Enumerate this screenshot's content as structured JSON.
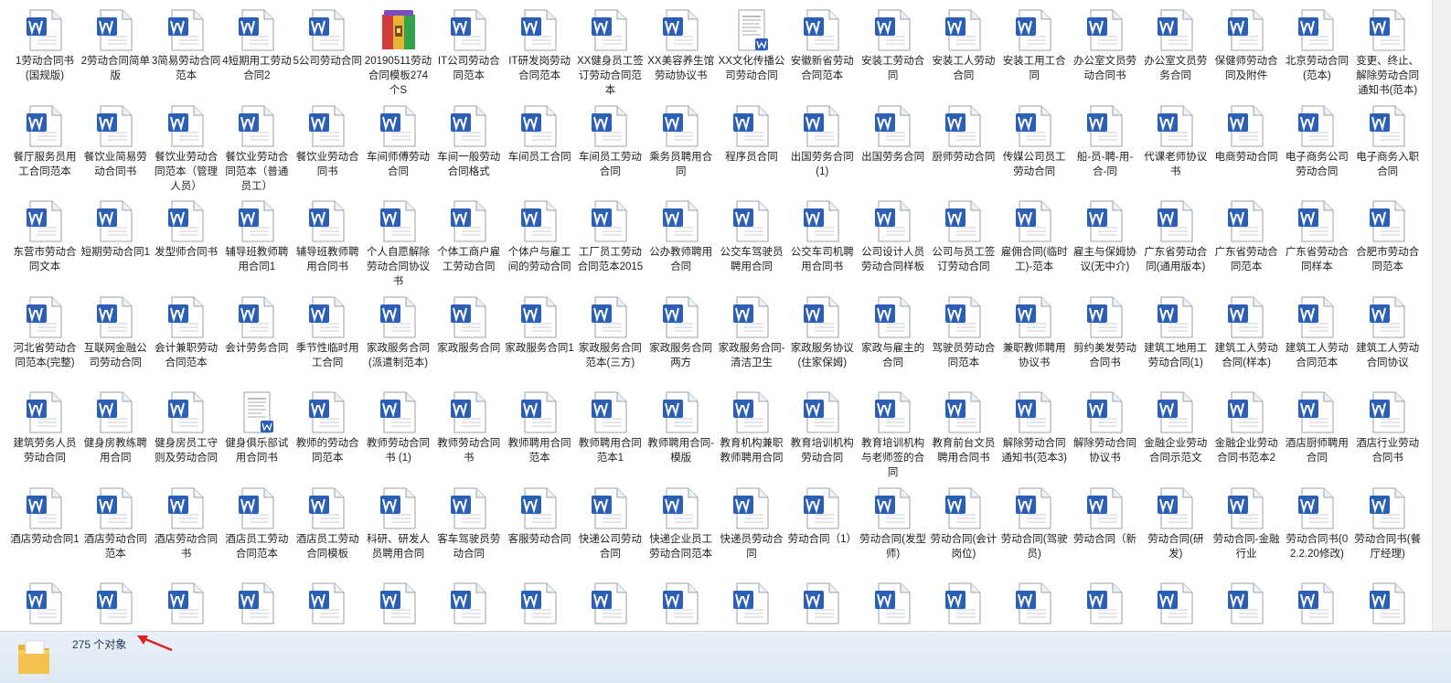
{
  "window": {
    "scrollbar": "vertical-scrollbar"
  },
  "files": [
    {
      "label": "1劳动合同书(国规版)",
      "icon": "word-doc-icon"
    },
    {
      "label": "2劳动合同简单版",
      "icon": "word-doc-icon"
    },
    {
      "label": "3简易劳动合同范本",
      "icon": "word-doc-icon"
    },
    {
      "label": "4短期用工劳动合同2",
      "icon": "word-doc-icon"
    },
    {
      "label": "5公司劳动合同",
      "icon": "word-doc-icon"
    },
    {
      "label": "20190511劳动合同模板274个S",
      "icon": "archive-icon"
    },
    {
      "label": "IT公司劳动合同范本",
      "icon": "word-doc-icon"
    },
    {
      "label": "IT研发岗劳动合同范本",
      "icon": "word-doc-icon"
    },
    {
      "label": "XX健身员工签订劳动合同范本",
      "icon": "word-doc-icon"
    },
    {
      "label": "XX美容养生馆劳动协议书",
      "icon": "word-doc-icon"
    },
    {
      "label": "XX文化传播公司劳动合同",
      "icon": "doc-thumbnail-icon"
    },
    {
      "label": "安徽新省劳动合同范本",
      "icon": "word-doc-icon"
    },
    {
      "label": "安装工劳动合同",
      "icon": "word-doc-icon"
    },
    {
      "label": "安装工人劳动合同",
      "icon": "word-doc-icon"
    },
    {
      "label": "安装工用工合同",
      "icon": "word-doc-icon"
    },
    {
      "label": "办公室文员劳动合同书",
      "icon": "word-doc-icon"
    },
    {
      "label": "办公室文员劳务合同",
      "icon": "word-doc-icon"
    },
    {
      "label": "保健师劳动合同及附件",
      "icon": "word-doc-icon"
    },
    {
      "label": "北京劳动合同(范本)",
      "icon": "word-doc-icon"
    },
    {
      "label": "变更、终止、解除劳动合同通知书(范本)",
      "icon": "word-doc-icon"
    },
    {
      "label": "餐厅服务员用工合同范本",
      "icon": "word-doc-icon"
    },
    {
      "label": "餐饮业简易劳动合同书",
      "icon": "word-doc-icon"
    },
    {
      "label": "餐饮业劳动合同范本（管理人员）",
      "icon": "word-doc-icon"
    },
    {
      "label": "餐饮业劳动合同范本（普通员工）",
      "icon": "word-doc-icon"
    },
    {
      "label": "餐饮业劳动合同书",
      "icon": "word-doc-icon"
    },
    {
      "label": "车间师傅劳动合同",
      "icon": "word-doc-icon"
    },
    {
      "label": "车间一般劳动合同格式",
      "icon": "word-doc-icon"
    },
    {
      "label": "车间员工合同",
      "icon": "word-doc-icon"
    },
    {
      "label": "车间员工劳动合同",
      "icon": "word-doc-icon"
    },
    {
      "label": "乘务员聘用合同",
      "icon": "word-doc-icon"
    },
    {
      "label": "程序员合同",
      "icon": "word-doc-icon"
    },
    {
      "label": "出国劳务合同 (1)",
      "icon": "word-doc-icon"
    },
    {
      "label": "出国劳务合同",
      "icon": "word-doc-icon"
    },
    {
      "label": "厨师劳动合同",
      "icon": "word-doc-icon"
    },
    {
      "label": "传媒公司员工劳动合同",
      "icon": "word-doc-icon"
    },
    {
      "label": "船-员-聘-用-合-同",
      "icon": "word-doc-icon"
    },
    {
      "label": "代课老师协议书",
      "icon": "word-doc-icon"
    },
    {
      "label": "电商劳动合同",
      "icon": "word-doc-icon"
    },
    {
      "label": "电子商务公司劳动合同",
      "icon": "word-doc-icon"
    },
    {
      "label": "电子商务入职合同",
      "icon": "word-doc-icon"
    },
    {
      "label": "东营市劳动合同文本",
      "icon": "word-doc-icon"
    },
    {
      "label": "短期劳动合同1",
      "icon": "word-doc-icon"
    },
    {
      "label": "发型师合同书",
      "icon": "word-doc-icon"
    },
    {
      "label": "辅导班教师聘用合同1",
      "icon": "word-doc-icon"
    },
    {
      "label": "辅导班教师聘用合同书",
      "icon": "word-doc-icon"
    },
    {
      "label": "个人自愿解除劳动合同协议书",
      "icon": "word-doc-icon"
    },
    {
      "label": "个体工商户雇工劳动合同",
      "icon": "word-doc-icon"
    },
    {
      "label": "个体户与雇工间的劳动合同",
      "icon": "word-doc-icon"
    },
    {
      "label": "工厂员工劳动合同范本2015",
      "icon": "word-doc-icon"
    },
    {
      "label": "公办教师聘用合同",
      "icon": "word-doc-icon"
    },
    {
      "label": "公交车驾驶员聘用合同",
      "icon": "word-doc-icon"
    },
    {
      "label": "公交车司机聘用合同书",
      "icon": "word-doc-icon"
    },
    {
      "label": "公司设计人员劳动合同样板",
      "icon": "word-doc-icon"
    },
    {
      "label": "公司与员工签订劳动合同",
      "icon": "word-doc-icon"
    },
    {
      "label": "雇佣合同(临时工)-范本",
      "icon": "word-doc-icon"
    },
    {
      "label": "雇主与保姆协议(无中介)",
      "icon": "word-doc-icon"
    },
    {
      "label": "广东省劳动合同(通用版本)",
      "icon": "word-doc-icon"
    },
    {
      "label": "广东省劳动合同范本",
      "icon": "word-doc-icon"
    },
    {
      "label": "广东省劳动合同样本",
      "icon": "word-doc-icon"
    },
    {
      "label": "合肥市劳动合同范本",
      "icon": "word-doc-icon"
    },
    {
      "label": "河北省劳动合同范本(完整)",
      "icon": "word-doc-icon"
    },
    {
      "label": "互联网金融公司劳动合同",
      "icon": "word-doc-icon"
    },
    {
      "label": "会计兼职劳动合同范本",
      "icon": "word-doc-icon"
    },
    {
      "label": "会计劳务合同",
      "icon": "word-doc-icon"
    },
    {
      "label": "季节性临时用工合同",
      "icon": "word-doc-icon"
    },
    {
      "label": "家政服务合同(派遣制范本)",
      "icon": "word-doc-icon"
    },
    {
      "label": "家政服务合同",
      "icon": "word-doc-icon"
    },
    {
      "label": "家政服务合同1",
      "icon": "word-doc-icon"
    },
    {
      "label": "家政服务合同范本(三方)",
      "icon": "word-doc-icon"
    },
    {
      "label": "家政服务合同两方",
      "icon": "word-doc-icon"
    },
    {
      "label": "家政服务合同-清洁卫生",
      "icon": "word-doc-icon"
    },
    {
      "label": "家政服务协议(住家保姆)",
      "icon": "word-doc-icon"
    },
    {
      "label": "家政与雇主的合同",
      "icon": "word-doc-icon"
    },
    {
      "label": "驾驶员劳动合同范本",
      "icon": "word-doc-icon"
    },
    {
      "label": "兼职教师聘用协议书",
      "icon": "word-doc-icon"
    },
    {
      "label": "剪约美发劳动合同书",
      "icon": "word-doc-icon"
    },
    {
      "label": "建筑工地用工劳动合同(1)",
      "icon": "word-doc-icon"
    },
    {
      "label": "建筑工人劳动合同(样本)",
      "icon": "word-doc-icon"
    },
    {
      "label": "建筑工人劳动合同范本",
      "icon": "word-doc-icon"
    },
    {
      "label": "建筑工人劳动合同协议",
      "icon": "word-doc-icon"
    },
    {
      "label": "建筑劳务人员劳动合同",
      "icon": "word-doc-icon"
    },
    {
      "label": "健身房教练聘用合同",
      "icon": "word-doc-icon"
    },
    {
      "label": "健身房员工守则及劳动合同",
      "icon": "word-doc-icon"
    },
    {
      "label": "健身俱乐部试用合同书",
      "icon": "doc-thumbnail-icon"
    },
    {
      "label": "教师的劳动合同范本",
      "icon": "word-doc-icon"
    },
    {
      "label": "教师劳动合同书 (1)",
      "icon": "word-doc-icon"
    },
    {
      "label": "教师劳动合同书",
      "icon": "word-doc-icon"
    },
    {
      "label": "教师聘用合同范本",
      "icon": "word-doc-icon"
    },
    {
      "label": "教师聘用合同范本1",
      "icon": "word-doc-icon"
    },
    {
      "label": "教师聘用合同-模版",
      "icon": "word-doc-icon"
    },
    {
      "label": "教育机构兼职教师聘用合同",
      "icon": "word-doc-icon"
    },
    {
      "label": "教育培训机构劳动合同",
      "icon": "word-doc-icon"
    },
    {
      "label": "教育培训机构与老师签的合同",
      "icon": "word-doc-icon"
    },
    {
      "label": "教育前台文员聘用合同书",
      "icon": "word-doc-icon"
    },
    {
      "label": "解除劳动合同通知书(范本3)",
      "icon": "word-doc-icon"
    },
    {
      "label": "解除劳动合同协议书",
      "icon": "word-doc-icon"
    },
    {
      "label": "金融企业劳动合同示范文",
      "icon": "word-doc-icon"
    },
    {
      "label": "金融企业劳动合同书范本2",
      "icon": "word-doc-icon"
    },
    {
      "label": "酒店厨师聘用合同",
      "icon": "word-doc-icon"
    },
    {
      "label": "酒店行业劳动合同书",
      "icon": "word-doc-icon"
    },
    {
      "label": "酒店劳动合同1",
      "icon": "word-doc-icon"
    },
    {
      "label": "酒店劳动合同范本",
      "icon": "word-doc-icon"
    },
    {
      "label": "酒店劳动合同书",
      "icon": "word-doc-icon"
    },
    {
      "label": "酒店员工劳动合同范本",
      "icon": "word-doc-icon"
    },
    {
      "label": "酒店员工劳动合同模板",
      "icon": "word-doc-icon"
    },
    {
      "label": "科研、研发人员聘用合同",
      "icon": "word-doc-icon"
    },
    {
      "label": "客车驾驶员劳动合同",
      "icon": "word-doc-icon"
    },
    {
      "label": "客服劳动合同",
      "icon": "word-doc-icon"
    },
    {
      "label": "快递公司劳动合同",
      "icon": "word-doc-icon"
    },
    {
      "label": "快递企业员工劳动合同范本",
      "icon": "word-doc-icon"
    },
    {
      "label": "快递员劳动合同",
      "icon": "word-doc-icon"
    },
    {
      "label": "劳动合同（1）",
      "icon": "word-doc-icon"
    },
    {
      "label": "劳动合同(发型师)",
      "icon": "word-doc-icon"
    },
    {
      "label": "劳动合同(会计岗位)",
      "icon": "word-doc-icon"
    },
    {
      "label": "劳动合同(驾驶员)",
      "icon": "word-doc-icon"
    },
    {
      "label": "劳动合同（新",
      "icon": "word-doc-icon"
    },
    {
      "label": "劳动合同(研发)",
      "icon": "word-doc-icon"
    },
    {
      "label": "劳动合同-金融行业",
      "icon": "word-doc-icon"
    },
    {
      "label": "劳动合同书(02.2.20修改)",
      "icon": "word-doc-icon"
    },
    {
      "label": "劳动合同书(餐厅经理)",
      "icon": "word-doc-icon"
    },
    {
      "label": "",
      "icon": "word-doc-icon"
    },
    {
      "label": "",
      "icon": "word-doc-icon"
    },
    {
      "label": "",
      "icon": "word-doc-icon"
    },
    {
      "label": "",
      "icon": "word-doc-icon"
    },
    {
      "label": "",
      "icon": "word-doc-icon"
    },
    {
      "label": "",
      "icon": "word-doc-icon"
    },
    {
      "label": "",
      "icon": "word-doc-icon"
    },
    {
      "label": "",
      "icon": "word-doc-icon"
    },
    {
      "label": "",
      "icon": "word-doc-icon"
    },
    {
      "label": "",
      "icon": "word-doc-icon"
    },
    {
      "label": "",
      "icon": "word-doc-icon"
    },
    {
      "label": "",
      "icon": "word-doc-icon"
    },
    {
      "label": "",
      "icon": "word-doc-icon"
    },
    {
      "label": "",
      "icon": "word-doc-icon"
    },
    {
      "label": "",
      "icon": "word-doc-icon"
    },
    {
      "label": "",
      "icon": "word-doc-icon"
    },
    {
      "label": "",
      "icon": "word-doc-icon"
    },
    {
      "label": "",
      "icon": "word-doc-icon"
    },
    {
      "label": "",
      "icon": "word-doc-icon"
    },
    {
      "label": "",
      "icon": "word-doc-icon"
    }
  ],
  "status_bar": {
    "count_text": "275 个对象",
    "icon": "folder-icon",
    "annotation": "red-arrow-icon"
  },
  "colors": {
    "word_blue": "#2b5fb5",
    "status_bg": "#e4ecf6",
    "arrow_red": "#e02020",
    "folder_yellow": "#f2c24d"
  }
}
